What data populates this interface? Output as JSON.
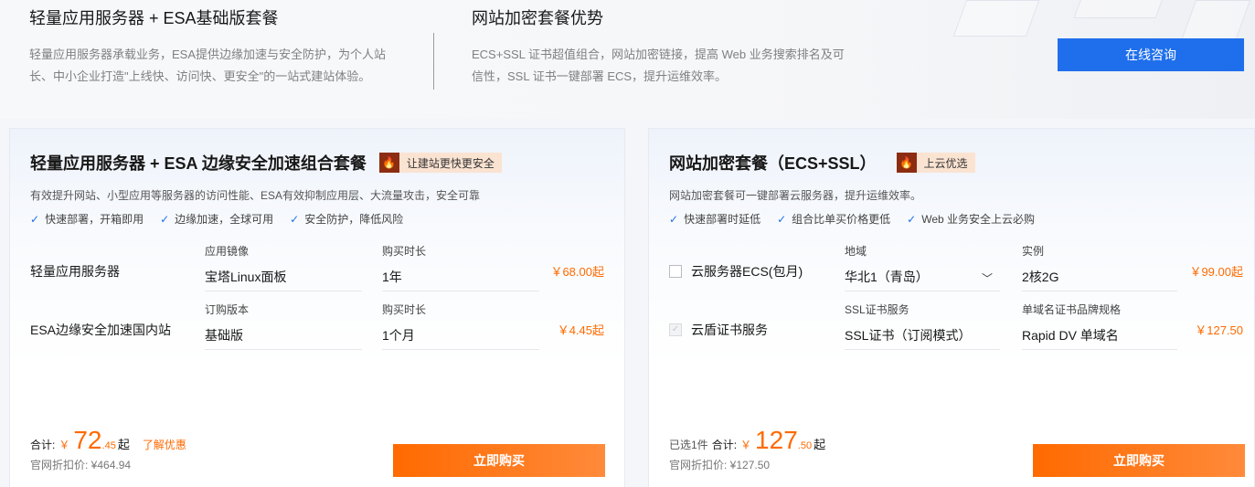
{
  "top": {
    "col1": {
      "title": "轻量应用服务器 + ESA基础版套餐",
      "desc": "轻量应用服务器承载业务，ESA提供边缘加速与安全防护，为个人站长、中小企业打造\"上线快、访问快、更安全\"的一站式建站体验。"
    },
    "col2": {
      "title": "网站加密套餐优势",
      "desc": "ECS+SSL 证书超值组合，网站加密链接，提高 Web 业务搜索排名及可信性，SSL 证书一键部署 ECS，提升运维效率。"
    },
    "consult_label": "在线咨询"
  },
  "left_card": {
    "title": "轻量应用服务器 + ESA 边缘安全加速组合套餐",
    "tag": "让建站更快更安全",
    "subtitle": "有效提升网站、小型应用等服务器的访问性能、ESA有效抑制应用层、大流量攻击，安全可靠",
    "checks": [
      "快速部署，开箱即用",
      "边缘加速，全球可用",
      "安全防护，降低风险"
    ],
    "rows": [
      {
        "name": "轻量应用服务器",
        "f1_label": "应用镜像",
        "f1_value": "宝塔Linux面板",
        "f2_label": "购买时长",
        "f2_value": "1年",
        "price": "￥68.00起"
      },
      {
        "name": "ESA边缘安全加速国内站",
        "f1_label": "订购版本",
        "f1_value": "基础版",
        "f2_label": "购买时长",
        "f2_value": "1个月",
        "price": "￥4.45起"
      }
    ],
    "total_label": "合计:",
    "currency": "￥",
    "total_int": "72",
    "total_dec": ".45",
    "total_suffix": "起",
    "promo": "了解优惠",
    "orig_price": "官网折扣价: ¥464.94",
    "buy_label": "立即购买"
  },
  "right_card": {
    "title": "网站加密套餐（ECS+SSL）",
    "tag": "上云优选",
    "subtitle": "网站加密套餐可一键部署云服务器，提升运维效率。",
    "checks": [
      "快速部署时延低",
      "组合比单买价格更低",
      "Web 业务安全上云必购"
    ],
    "rows": [
      {
        "name": "云服务器ECS(包月)",
        "f1_label": "地域",
        "f1_value": "华北1（青岛）",
        "f2_label": "实例",
        "f2_value": "2核2G",
        "price": "￥99.00起"
      },
      {
        "name": "云盾证书服务",
        "f1_label": "SSL证书服务",
        "f1_value": "SSL证书（订阅模式）",
        "f2_label": "单域名证书品牌规格",
        "f2_value": "Rapid DV 单域名",
        "price": "￥127.50"
      }
    ],
    "selected_count": "已选1件",
    "total_label": "合计:",
    "currency": "￥",
    "total_int": "127",
    "total_dec": ".50",
    "total_suffix": "起",
    "orig_price": "官网折扣价: ¥127.50",
    "buy_label": "立即购买"
  },
  "icons": {
    "fire": "fire-icon",
    "check": "check-icon",
    "chevron": "chevron-down-icon"
  },
  "colors": {
    "primary_blue": "#1f6fec",
    "orange": "#ff6a00",
    "tag_bg": "#fbe3d2"
  }
}
